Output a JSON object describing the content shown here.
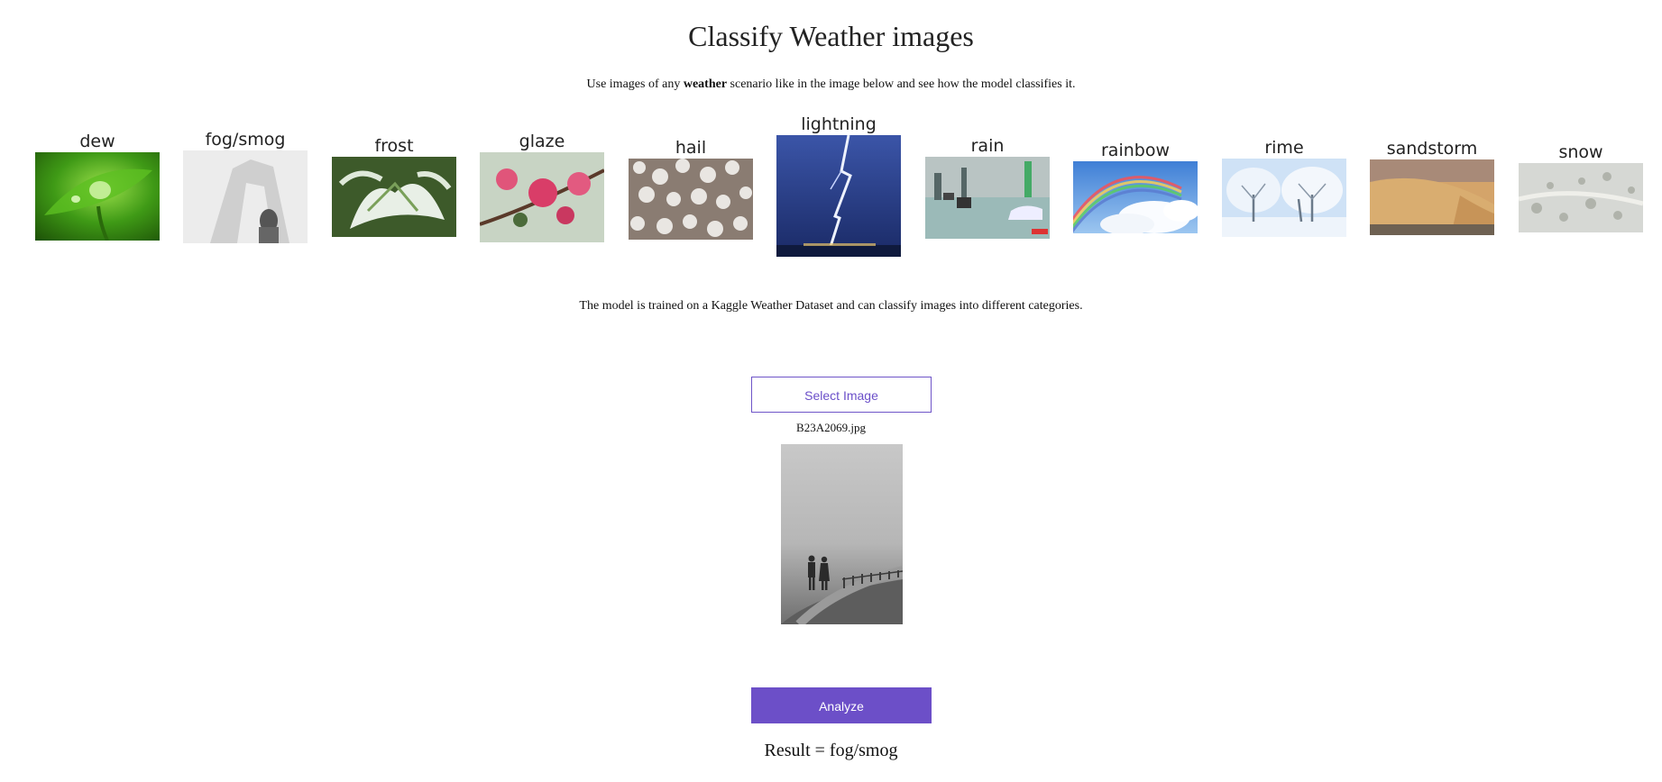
{
  "page": {
    "title": "Classify Weather images",
    "intro_prefix": "Use images of any",
    "intro_bold": "weather",
    "intro_suffix": "scenario like in the image below and see how the model classifies it.",
    "trained_text": "The model is trained on a Kaggle Weather Dataset and can classify images into different categories."
  },
  "samples": [
    {
      "label": "dew"
    },
    {
      "label": "fog/smog"
    },
    {
      "label": "frost"
    },
    {
      "label": "glaze"
    },
    {
      "label": "hail"
    },
    {
      "label": "lightning"
    },
    {
      "label": "rain"
    },
    {
      "label": "rainbow"
    },
    {
      "label": "rime"
    },
    {
      "label": "sandstorm"
    },
    {
      "label": "snow"
    }
  ],
  "upload": {
    "select_label": "Select Image",
    "filename": "B23A2069.jpg"
  },
  "actions": {
    "analyze_label": "Analyze"
  },
  "result": {
    "text": "Result = fog/smog"
  },
  "colors": {
    "accent": "#6c4fc8",
    "background": "#ffffff"
  }
}
